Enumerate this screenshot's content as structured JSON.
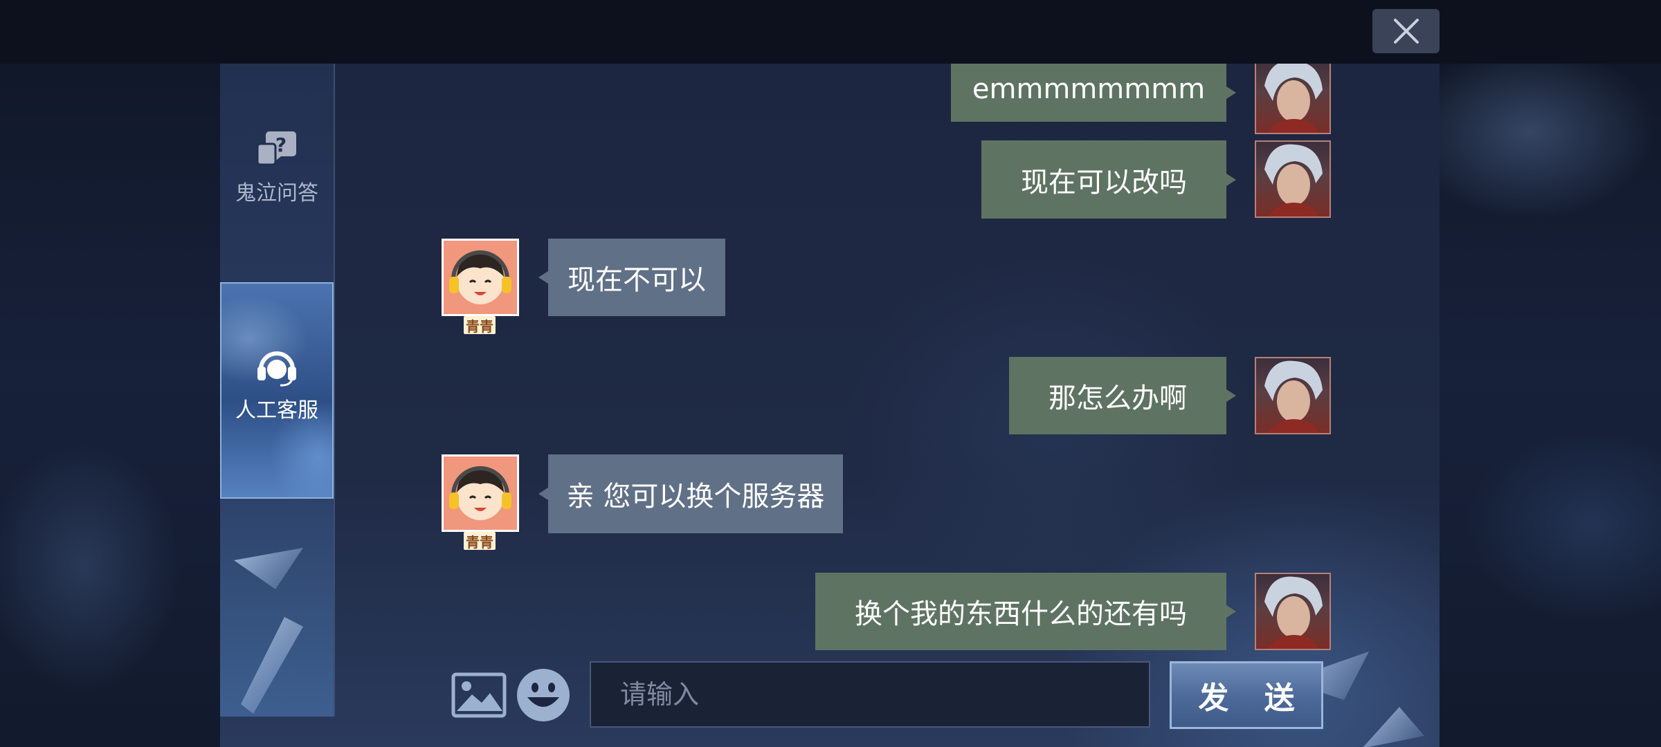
{
  "window": {
    "close_icon": "close-icon"
  },
  "sidebar": {
    "items": [
      {
        "label": "鬼泣问答",
        "icon": "question-chat-icon",
        "selected": false
      },
      {
        "label": "人工客服",
        "icon": "headset-icon",
        "selected": true
      }
    ]
  },
  "messages": [
    {
      "from": "user",
      "text": "emmmmmmmm"
    },
    {
      "from": "user",
      "text": "现在可以改吗"
    },
    {
      "from": "agent",
      "text": "现在不可以",
      "name": "青青"
    },
    {
      "from": "user",
      "text": "那怎么办啊"
    },
    {
      "from": "agent",
      "text": "亲 您可以换个服务器",
      "name": "青青"
    },
    {
      "from": "user",
      "text": "换个我的东西什么的还有吗"
    }
  ],
  "composer": {
    "image_icon": "image-icon",
    "emoji_icon": "emoji-icon",
    "placeholder": "请输入",
    "value": "",
    "send_label": "发 送"
  },
  "colors": {
    "user_bubble": "#5f7363",
    "agent_bubble": "#607087",
    "accent": "#9ab6dc"
  }
}
